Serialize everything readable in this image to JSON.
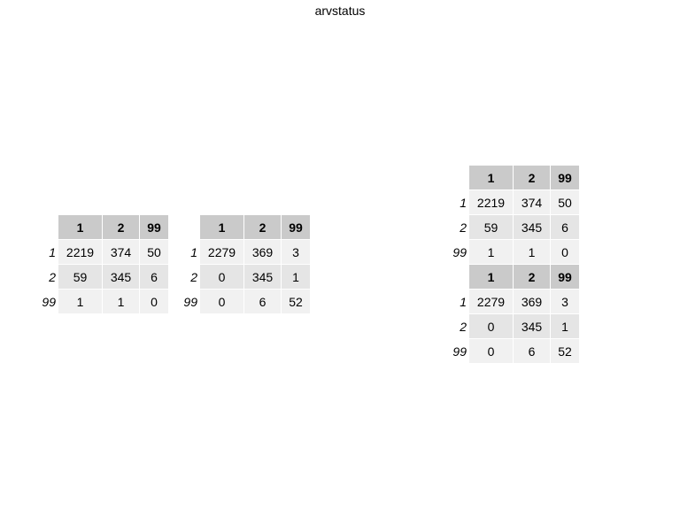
{
  "title": "arvstatus",
  "colors": {
    "header_bg": "#cacaca",
    "row_odd_bg": "#f1f1f1",
    "row_even_bg": "#e5e5e5",
    "border": "#ffffff"
  },
  "tables": [
    {
      "columns": [
        "1",
        "2",
        "99"
      ],
      "rows": [
        {
          "label": "1",
          "values": [
            "2219",
            "374",
            "50"
          ]
        },
        {
          "label": "2",
          "values": [
            "59",
            "345",
            "6"
          ]
        },
        {
          "label": "99",
          "values": [
            "1",
            "1",
            "0"
          ]
        }
      ]
    },
    {
      "columns": [
        "1",
        "2",
        "99"
      ],
      "rows": [
        {
          "label": "1",
          "values": [
            "2279",
            "369",
            "3"
          ]
        },
        {
          "label": "2",
          "values": [
            "0",
            "345",
            "1"
          ]
        },
        {
          "label": "99",
          "values": [
            "0",
            "6",
            "52"
          ]
        }
      ]
    },
    {
      "columns": [
        "1",
        "2",
        "99"
      ],
      "rows": [
        {
          "label": "1",
          "values": [
            "2219",
            "374",
            "50"
          ]
        },
        {
          "label": "2",
          "values": [
            "59",
            "345",
            "6"
          ]
        },
        {
          "label": "99",
          "values": [
            "1",
            "1",
            "0"
          ]
        }
      ]
    },
    {
      "columns": [
        "1",
        "2",
        "99"
      ],
      "rows": [
        {
          "label": "1",
          "values": [
            "2279",
            "369",
            "3"
          ]
        },
        {
          "label": "2",
          "values": [
            "0",
            "345",
            "1"
          ]
        },
        {
          "label": "99",
          "values": [
            "0",
            "6",
            "52"
          ]
        }
      ]
    }
  ]
}
